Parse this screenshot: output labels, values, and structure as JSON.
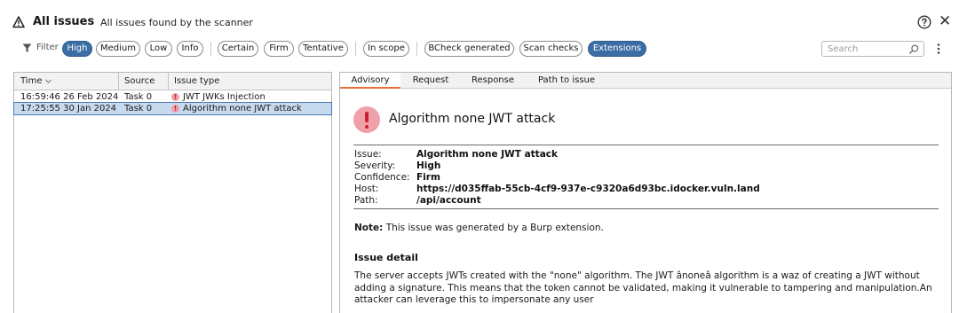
{
  "header": {
    "title": "All issues",
    "subtitle": "All issues found by the scanner"
  },
  "filter": {
    "label": "Filter",
    "severity": [
      {
        "label": "High",
        "active": true
      },
      {
        "label": "Medium",
        "active": false
      },
      {
        "label": "Low",
        "active": false
      },
      {
        "label": "Info",
        "active": false
      }
    ],
    "confidence": [
      {
        "label": "Certain",
        "active": false
      },
      {
        "label": "Firm",
        "active": false
      },
      {
        "label": "Tentative",
        "active": false
      }
    ],
    "scope": [
      {
        "label": "In scope",
        "active": false
      }
    ],
    "source": [
      {
        "label": "BCheck generated",
        "active": false
      },
      {
        "label": "Scan checks",
        "active": false
      },
      {
        "label": "Extensions",
        "active": true
      }
    ],
    "search_placeholder": "Search"
  },
  "table": {
    "columns": [
      "Time",
      "Source",
      "Issue type"
    ],
    "rows": [
      {
        "time": "16:59:46 26 Feb 2024",
        "source": "Task 0",
        "issue": "JWT JWKs Injection",
        "selected": false
      },
      {
        "time": "17:25:55 30 Jan 2024",
        "source": "Task 0",
        "issue": "Algorithm none JWT attack",
        "selected": true
      }
    ]
  },
  "tabs": [
    "Advisory",
    "Request",
    "Response",
    "Path to issue"
  ],
  "advisory": {
    "title": "Algorithm none JWT attack",
    "fields": [
      {
        "key": "Issue:",
        "value": "Algorithm none JWT attack"
      },
      {
        "key": "Severity:",
        "value": "High"
      },
      {
        "key": "Confidence:",
        "value": "Firm"
      },
      {
        "key": "Host:",
        "value": "https://d035ffab-55cb-4cf9-937e-c9320a6d93bc.idocker.vuln.land"
      },
      {
        "key": "Path:",
        "value": "/api/account"
      }
    ],
    "note_label": "Note:",
    "note_text": "This issue was generated by a Burp extension.",
    "detail_heading": "Issue detail",
    "detail_text": "The server accepts JWTs created with the \"none\" algorithm. The JWT ânoneâ algorithm is a waz of creating a JWT without adding a signature. This means that the token cannot be validated, making it vulnerable to tampering and manipulation.An attacker can leverage this to impersonate any user"
  },
  "colors": {
    "chip_active": "#3b6ea5",
    "severity_high": "#c8202f",
    "severity_high_bg": "#f0a0a8",
    "row_selected": "#c8daee",
    "tab_accent": "#e8703a"
  }
}
